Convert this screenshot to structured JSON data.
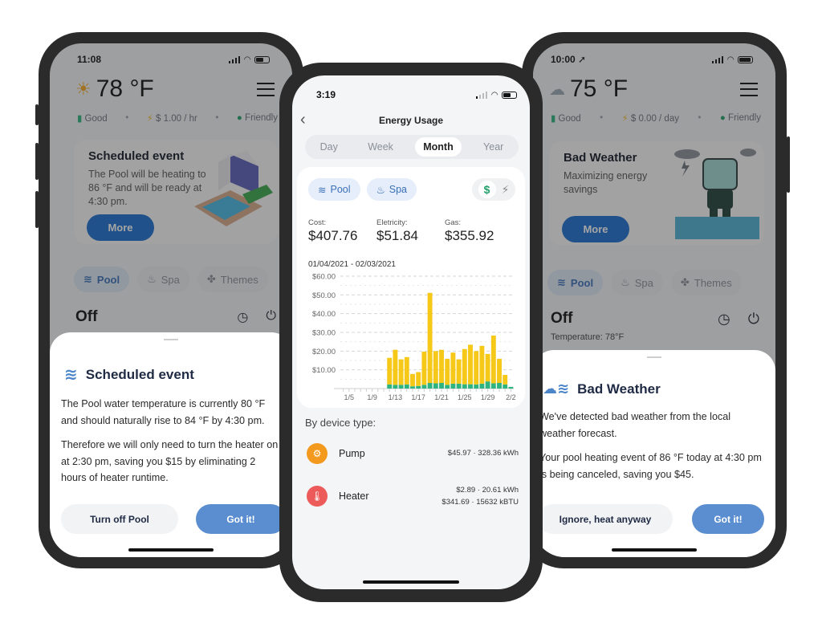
{
  "left_phone": {
    "status_time": "11:08",
    "temperature": "78 °F",
    "weather_icon": "sun-icon",
    "stats": [
      {
        "icon": "water-quality-icon",
        "label": "Good"
      },
      {
        "icon": "bolt-icon",
        "label": "$ 1.00 / hr"
      },
      {
        "icon": "leaf-icon",
        "label": "Friendly"
      }
    ],
    "promo": {
      "title": "Scheduled event",
      "body": "The Pool will be heating to 86 °F and will be ready at 4:30 pm.",
      "button": "More"
    },
    "tabs": [
      {
        "label": "Pool",
        "active": true
      },
      {
        "label": "Spa",
        "active": false
      },
      {
        "label": "Themes",
        "active": false
      }
    ],
    "state": "Off",
    "sheet": {
      "title": "Scheduled event",
      "paragraphs": [
        "The Pool water temperature is currently 80 °F and should naturally rise to 84 °F by 4:30 pm.",
        "Therefore we will only need to turn the heater on at 2:30 pm, saving you $15 by eliminating 2 hours of heater runtime."
      ],
      "secondary_button": "Turn off Pool",
      "primary_button": "Got it!"
    }
  },
  "middle_phone": {
    "status_time": "3:19",
    "title": "Energy Usage",
    "periods": [
      {
        "label": "Day",
        "active": false
      },
      {
        "label": "Week",
        "active": false
      },
      {
        "label": "Month",
        "active": true
      },
      {
        "label": "Year",
        "active": false
      }
    ],
    "chips": [
      {
        "label": "Pool"
      },
      {
        "label": "Spa"
      }
    ],
    "toggle": {
      "on": "$",
      "off": "⚡"
    },
    "costs": [
      {
        "label": "Cost:",
        "value": "$407.76"
      },
      {
        "label": "Eletricity:",
        "value": "$51.84"
      },
      {
        "label": "Gas:",
        "value": "$355.92"
      }
    ],
    "date_range": "01/04/2021 - 02/03/2021",
    "device_heading": "By device type:",
    "devices": [
      {
        "name": "Pump",
        "values": [
          "$45.97 · 328.36 kWh"
        ],
        "color": "#f39a1e"
      },
      {
        "name": "Heater",
        "values": [
          "$2.89 · 20.61 kWh",
          "$341.69 · 15632 kBTU"
        ],
        "color": "#ec5a5a"
      }
    ]
  },
  "right_phone": {
    "status_time": "10:00 ➚",
    "temperature": "75 °F",
    "weather_icon": "storm-cloud-icon",
    "stats": [
      {
        "icon": "water-quality-icon",
        "label": "Good"
      },
      {
        "icon": "bolt-icon",
        "label": "$ 0.00 / day"
      },
      {
        "icon": "leaf-icon",
        "label": "Friendly"
      }
    ],
    "promo": {
      "title": "Bad Weather",
      "body": "Maximizing energy savings",
      "button": "More"
    },
    "tabs": [
      {
        "label": "Pool",
        "active": true
      },
      {
        "label": "Spa",
        "active": false
      },
      {
        "label": "Themes",
        "active": false
      }
    ],
    "state": "Off",
    "state_sub": "Temperature: 78°F",
    "sheet": {
      "title": "Bad Weather",
      "paragraphs": [
        "We've detected bad weather from the local weather forecast.",
        "Your pool heating event of 86 °F today at 4:30 pm is being canceled, saving you $45."
      ],
      "secondary_button": "Ignore, heat anyway",
      "primary_button": "Got it!"
    }
  },
  "chart_data": {
    "type": "bar",
    "stacked": true,
    "title": "",
    "xlabel": "",
    "ylabel": "",
    "ylim": [
      0,
      60
    ],
    "yticks": [
      "$10.00",
      "$20.00",
      "$30.00",
      "$40.00",
      "$50.00",
      "$60.00"
    ],
    "ytick_values": [
      10,
      20,
      30,
      40,
      50,
      60
    ],
    "xticks": [
      "1/5",
      "1/9",
      "1/13",
      "1/17",
      "1/21",
      "1/25",
      "1/29",
      "2/2"
    ],
    "categories": [
      "1/4",
      "1/5",
      "1/6",
      "1/7",
      "1/8",
      "1/9",
      "1/10",
      "1/11",
      "1/12",
      "1/13",
      "1/14",
      "1/15",
      "1/16",
      "1/17",
      "1/18",
      "1/19",
      "1/20",
      "1/21",
      "1/22",
      "1/23",
      "1/24",
      "1/25",
      "1/26",
      "1/27",
      "1/28",
      "1/29",
      "1/30",
      "1/31",
      "2/1",
      "2/2"
    ],
    "series": [
      {
        "name": "Electricity",
        "color": "#2fb37f",
        "values": [
          0,
          0,
          0,
          0,
          0,
          0,
          0,
          0,
          2.2,
          2.0,
          2.0,
          2.2,
          1.2,
          1.4,
          2.0,
          3.0,
          2.8,
          3.0,
          2.0,
          2.6,
          2.6,
          2.3,
          2.3,
          2.2,
          2.6,
          3.8,
          2.8,
          3.0,
          2.2,
          0.9
        ]
      },
      {
        "name": "Gas",
        "color": "#f6c818",
        "values": [
          0,
          0,
          0,
          0,
          0,
          0,
          0,
          0,
          14.2,
          18.7,
          13.6,
          14.6,
          6.6,
          7.4,
          17.7,
          48.1,
          17.2,
          17.7,
          13.9,
          16.6,
          13.0,
          18.8,
          21.1,
          17.8,
          20.2,
          14.7,
          25.5,
          12.9,
          5.1,
          0
        ]
      }
    ],
    "grid": true,
    "legend": "none"
  }
}
